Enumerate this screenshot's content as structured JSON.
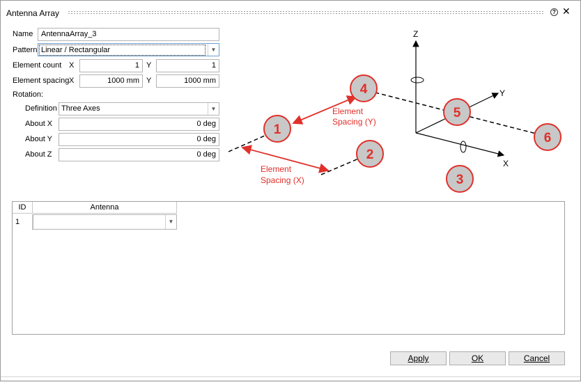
{
  "window": {
    "title": "Antenna Array"
  },
  "form": {
    "name_label": "Name",
    "name_value": "AntennaArray_3",
    "pattern_label": "Pattern",
    "pattern_value": "Linear / Rectangular",
    "element_count_label": "Element count",
    "element_count_x_label": "X",
    "element_count_x": "1",
    "element_count_y_label": "Y",
    "element_count_y": "1",
    "element_spacing_label": "Element spacing",
    "element_spacing_x_label": "X",
    "element_spacing_x": "1000 mm",
    "element_spacing_y_label": "Y",
    "element_spacing_y": "1000 mm",
    "rotation_label": "Rotation:",
    "definition_label": "Definition",
    "definition_value": "Three Axes",
    "about_x_label": "About X",
    "about_x": "0 deg",
    "about_y_label": "About Y",
    "about_y": "0 deg",
    "about_z_label": "About Z",
    "about_z": "0 deg"
  },
  "diagram": {
    "axis_z": "Z",
    "axis_y": "Y",
    "axis_x": "X",
    "callouts": [
      "1",
      "2",
      "3",
      "4",
      "5",
      "6"
    ],
    "spacing_x_line1": "Element",
    "spacing_x_line2": "Spacing (X)",
    "spacing_y_line1": "Element",
    "spacing_y_line2": "Spacing (Y)",
    "colors": {
      "callout_fill": "#c8c8c8",
      "callout_border": "#e0302a",
      "callout_text": "#e0302a",
      "arrow": "#e0302a"
    }
  },
  "table": {
    "columns": [
      "ID",
      "Antenna"
    ],
    "rows": [
      {
        "id": "1",
        "antenna": ""
      }
    ]
  },
  "buttons": {
    "apply": "Apply",
    "ok": "OK",
    "cancel": "Cancel"
  }
}
